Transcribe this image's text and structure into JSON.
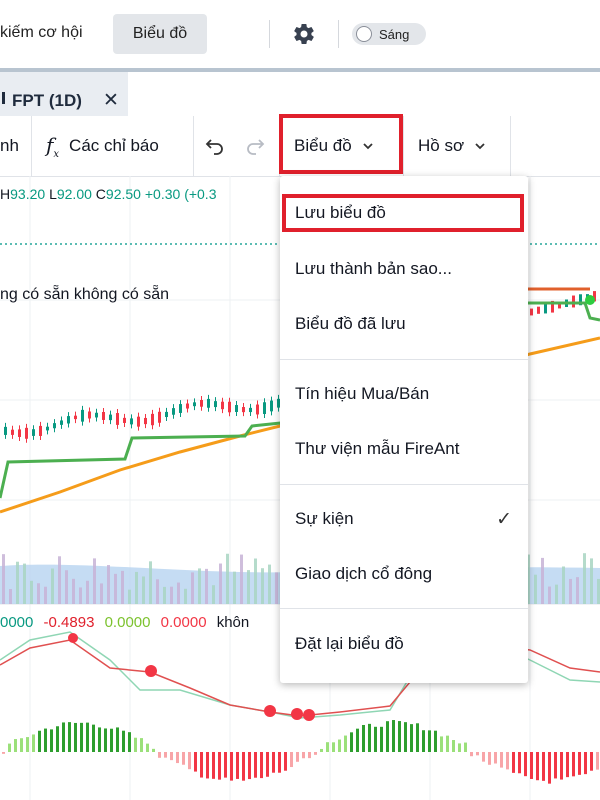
{
  "header": {
    "nav_text": "kiếm cơ hội",
    "chart_button": "Biểu đồ",
    "theme_label": "Sáng"
  },
  "tab": {
    "title": "FPT (1D)",
    "close": "✕"
  },
  "toolbar": {
    "partial": "nh",
    "indicators_icon": "fx",
    "indicators": "Các chỉ báo",
    "chart_menu": "Biểu đồ",
    "profile_menu": "Hồ sơ"
  },
  "legend": {
    "high": "93.20",
    "low": "92.00",
    "close": "92.50",
    "change": "+0.30",
    "pct": "(+0.3"
  },
  "not_available": "ng có sẵn  không có sẵn",
  "indicator_legend": {
    "v1": "0000",
    "v2": "-0.4893",
    "v3": "0.0000",
    "v4": "0.0000",
    "v5": "khôn"
  },
  "menu": {
    "items": [
      {
        "label": "Lưu biểu đồ"
      },
      {
        "label": "Lưu thành bản sao..."
      },
      {
        "label": "Biểu đồ đã lưu"
      },
      {
        "label": "Tín hiệu Mua/Bán"
      },
      {
        "label": "Thư viện mẫu FireAnt"
      },
      {
        "label": "Sự kiện",
        "checked": true
      },
      {
        "label": "Giao dịch cổ đông"
      },
      {
        "label": "Đặt lại biểu đồ"
      }
    ],
    "check_glyph": "✓"
  },
  "colors": {
    "up": "#089981",
    "down": "#f23645",
    "highlight": "#e0202c",
    "sma_orange": "#f59c1a",
    "sma_green": "#4caf50"
  }
}
